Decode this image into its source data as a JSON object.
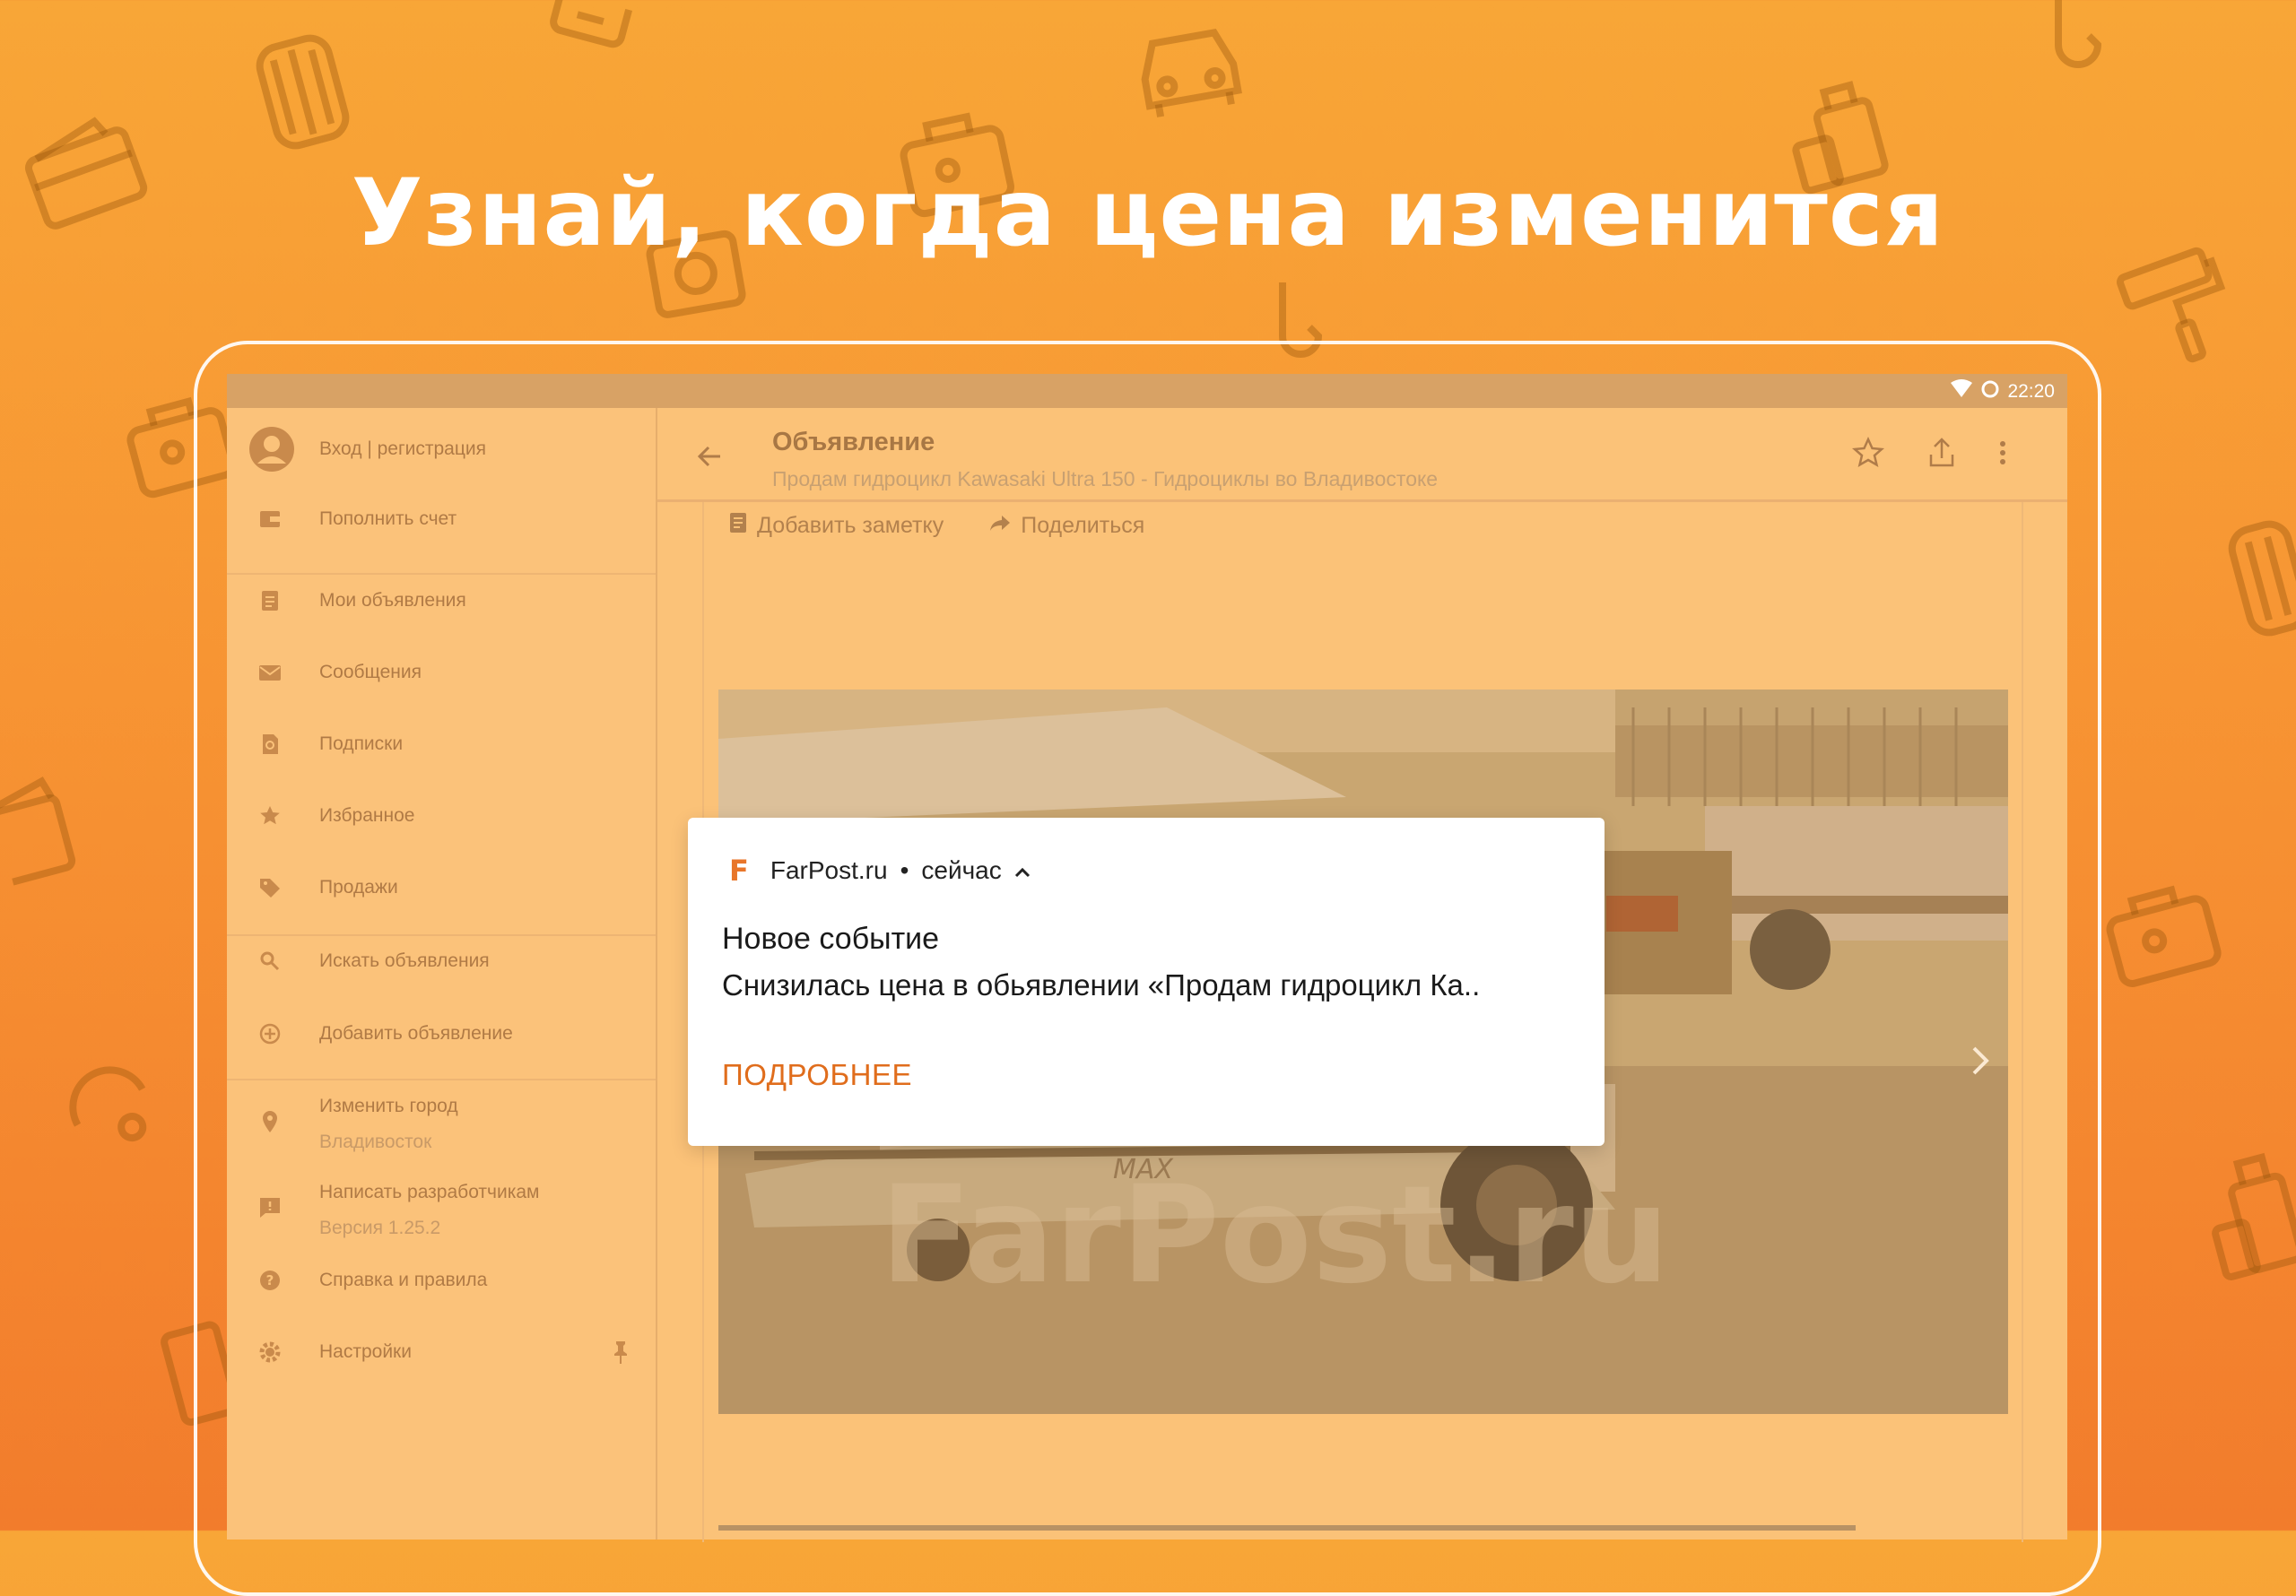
{
  "headline": "Узнай, когда цена изменится",
  "status_bar": {
    "time": "22:20",
    "icons": [
      "wifi-icon",
      "sync-icon"
    ]
  },
  "drawer": {
    "account": "Вход | регистрация",
    "items": [
      {
        "label": "Пополнить счет",
        "icon": "wallet-icon"
      },
      {
        "label": "Мои объявления",
        "icon": "document-icon"
      },
      {
        "label": "Сообщения",
        "icon": "mail-icon"
      },
      {
        "label": "Подписки",
        "icon": "subscription-icon"
      },
      {
        "label": "Избранное",
        "icon": "star-icon"
      },
      {
        "label": "Продажи",
        "icon": "tag-icon"
      },
      {
        "label": "Искать объявления",
        "icon": "search-icon"
      },
      {
        "label": "Добавить объявление",
        "icon": "add-circle-icon"
      },
      {
        "label": "Изменить город",
        "sub": "Владивосток",
        "icon": "location-pin-icon"
      },
      {
        "label": "Написать разработчикам",
        "sub": "Версия 1.25.2",
        "icon": "feedback-icon"
      },
      {
        "label": "Справка и правила",
        "icon": "help-icon"
      },
      {
        "label": "Настройки",
        "icon": "gear-icon"
      }
    ]
  },
  "appbar": {
    "title": "Объявление",
    "subtitle": "Продам гидроцикл Kawasaki Ultra 150 - Гидроциклы во Владивостоке"
  },
  "actions": {
    "note": "Добавить заметку",
    "share": "Поделиться"
  },
  "notification": {
    "app": "FarPost.ru",
    "separator": "•",
    "time": "сейчас",
    "title": "Новое событие",
    "body": "Снизилась цена в обьявлении  «Продам гидроцикл Ка..",
    "action": "ПОДРОБНЕЕ"
  },
  "colors": {
    "accent": "#e06d1c",
    "overlay": "#fbc278",
    "background": "#f79433"
  }
}
